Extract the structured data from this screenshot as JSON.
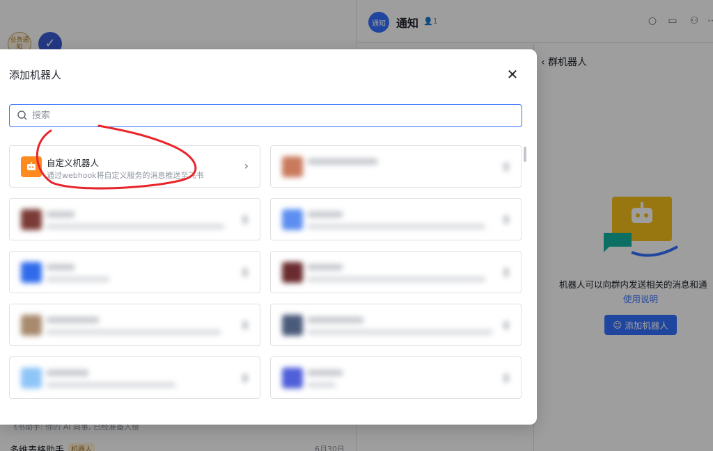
{
  "background": {
    "biz_chip": "业务通知",
    "bottom_text": "飞书助手: 你的 AI 同事, 已经准备入侵",
    "list_title": "多维表格助手",
    "list_tag": "机器人",
    "list_date": "6月30日",
    "chat_avatar": "通知",
    "chat_title": "通知",
    "member_count": "1",
    "panel_back": "群机器人",
    "panel_desc": "机器人可以向群内发送相关的消息和通",
    "panel_link": "使用说明",
    "panel_add_button": "添加机器人"
  },
  "modal": {
    "title": "添加机器人",
    "close_icon": "close-icon",
    "search": {
      "placeholder": "搜索",
      "value": ""
    },
    "custom_bot": {
      "name": "自定义机器人",
      "description": "通过webhook将自定义服务的消息推送至飞书"
    }
  },
  "colors": {
    "accent": "#3370ff",
    "robot_orange": "#ff8a1f",
    "annotation_red": "#e8252a"
  }
}
